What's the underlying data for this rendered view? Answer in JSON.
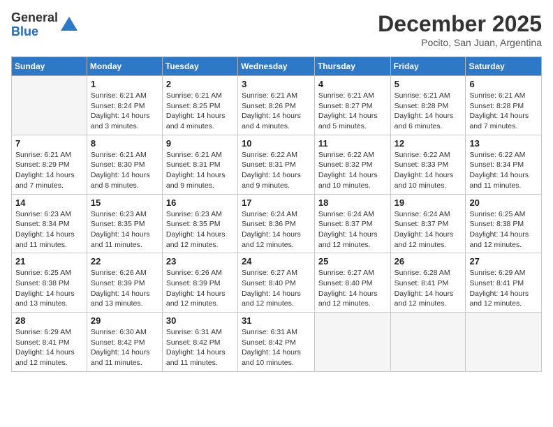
{
  "logo": {
    "general": "General",
    "blue": "Blue"
  },
  "title": "December 2025",
  "location": "Pocito, San Juan, Argentina",
  "days_of_week": [
    "Sunday",
    "Monday",
    "Tuesday",
    "Wednesday",
    "Thursday",
    "Friday",
    "Saturday"
  ],
  "weeks": [
    [
      {
        "day": "",
        "info": ""
      },
      {
        "day": "1",
        "info": "Sunrise: 6:21 AM\nSunset: 8:24 PM\nDaylight: 14 hours\nand 3 minutes."
      },
      {
        "day": "2",
        "info": "Sunrise: 6:21 AM\nSunset: 8:25 PM\nDaylight: 14 hours\nand 4 minutes."
      },
      {
        "day": "3",
        "info": "Sunrise: 6:21 AM\nSunset: 8:26 PM\nDaylight: 14 hours\nand 4 minutes."
      },
      {
        "day": "4",
        "info": "Sunrise: 6:21 AM\nSunset: 8:27 PM\nDaylight: 14 hours\nand 5 minutes."
      },
      {
        "day": "5",
        "info": "Sunrise: 6:21 AM\nSunset: 8:28 PM\nDaylight: 14 hours\nand 6 minutes."
      },
      {
        "day": "6",
        "info": "Sunrise: 6:21 AM\nSunset: 8:28 PM\nDaylight: 14 hours\nand 7 minutes."
      }
    ],
    [
      {
        "day": "7",
        "info": "Sunrise: 6:21 AM\nSunset: 8:29 PM\nDaylight: 14 hours\nand 7 minutes."
      },
      {
        "day": "8",
        "info": "Sunrise: 6:21 AM\nSunset: 8:30 PM\nDaylight: 14 hours\nand 8 minutes."
      },
      {
        "day": "9",
        "info": "Sunrise: 6:21 AM\nSunset: 8:31 PM\nDaylight: 14 hours\nand 9 minutes."
      },
      {
        "day": "10",
        "info": "Sunrise: 6:22 AM\nSunset: 8:31 PM\nDaylight: 14 hours\nand 9 minutes."
      },
      {
        "day": "11",
        "info": "Sunrise: 6:22 AM\nSunset: 8:32 PM\nDaylight: 14 hours\nand 10 minutes."
      },
      {
        "day": "12",
        "info": "Sunrise: 6:22 AM\nSunset: 8:33 PM\nDaylight: 14 hours\nand 10 minutes."
      },
      {
        "day": "13",
        "info": "Sunrise: 6:22 AM\nSunset: 8:34 PM\nDaylight: 14 hours\nand 11 minutes."
      }
    ],
    [
      {
        "day": "14",
        "info": "Sunrise: 6:23 AM\nSunset: 8:34 PM\nDaylight: 14 hours\nand 11 minutes."
      },
      {
        "day": "15",
        "info": "Sunrise: 6:23 AM\nSunset: 8:35 PM\nDaylight: 14 hours\nand 11 minutes."
      },
      {
        "day": "16",
        "info": "Sunrise: 6:23 AM\nSunset: 8:35 PM\nDaylight: 14 hours\nand 12 minutes."
      },
      {
        "day": "17",
        "info": "Sunrise: 6:24 AM\nSunset: 8:36 PM\nDaylight: 14 hours\nand 12 minutes."
      },
      {
        "day": "18",
        "info": "Sunrise: 6:24 AM\nSunset: 8:37 PM\nDaylight: 14 hours\nand 12 minutes."
      },
      {
        "day": "19",
        "info": "Sunrise: 6:24 AM\nSunset: 8:37 PM\nDaylight: 14 hours\nand 12 minutes."
      },
      {
        "day": "20",
        "info": "Sunrise: 6:25 AM\nSunset: 8:38 PM\nDaylight: 14 hours\nand 12 minutes."
      }
    ],
    [
      {
        "day": "21",
        "info": "Sunrise: 6:25 AM\nSunset: 8:38 PM\nDaylight: 14 hours\nand 13 minutes."
      },
      {
        "day": "22",
        "info": "Sunrise: 6:26 AM\nSunset: 8:39 PM\nDaylight: 14 hours\nand 13 minutes."
      },
      {
        "day": "23",
        "info": "Sunrise: 6:26 AM\nSunset: 8:39 PM\nDaylight: 14 hours\nand 12 minutes."
      },
      {
        "day": "24",
        "info": "Sunrise: 6:27 AM\nSunset: 8:40 PM\nDaylight: 14 hours\nand 12 minutes."
      },
      {
        "day": "25",
        "info": "Sunrise: 6:27 AM\nSunset: 8:40 PM\nDaylight: 14 hours\nand 12 minutes."
      },
      {
        "day": "26",
        "info": "Sunrise: 6:28 AM\nSunset: 8:41 PM\nDaylight: 14 hours\nand 12 minutes."
      },
      {
        "day": "27",
        "info": "Sunrise: 6:29 AM\nSunset: 8:41 PM\nDaylight: 14 hours\nand 12 minutes."
      }
    ],
    [
      {
        "day": "28",
        "info": "Sunrise: 6:29 AM\nSunset: 8:41 PM\nDaylight: 14 hours\nand 12 minutes."
      },
      {
        "day": "29",
        "info": "Sunrise: 6:30 AM\nSunset: 8:42 PM\nDaylight: 14 hours\nand 11 minutes."
      },
      {
        "day": "30",
        "info": "Sunrise: 6:31 AM\nSunset: 8:42 PM\nDaylight: 14 hours\nand 11 minutes."
      },
      {
        "day": "31",
        "info": "Sunrise: 6:31 AM\nSunset: 8:42 PM\nDaylight: 14 hours\nand 10 minutes."
      },
      {
        "day": "",
        "info": ""
      },
      {
        "day": "",
        "info": ""
      },
      {
        "day": "",
        "info": ""
      }
    ]
  ]
}
